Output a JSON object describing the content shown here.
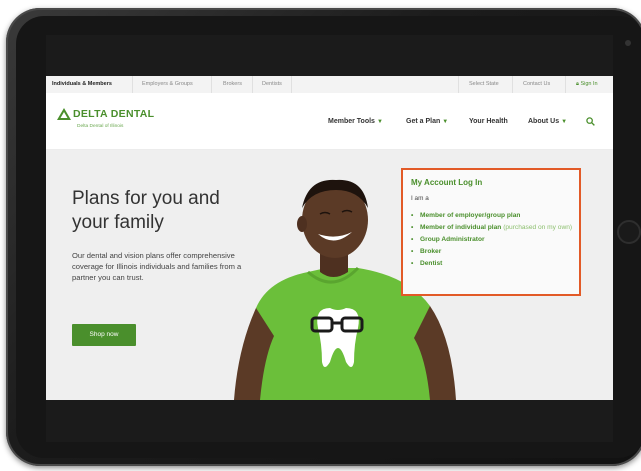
{
  "utility_bar": {
    "items": [
      "Individuals & Members",
      "Employers & Groups",
      "Brokers",
      "Dentists"
    ],
    "right_items": [
      "Select State",
      "Contact Us"
    ],
    "sign_in": "Sign In"
  },
  "header": {
    "logo_text": "DELTA DENTAL",
    "logo_subtext": "Delta Dental of Illinois",
    "nav": [
      {
        "label": "Member Tools",
        "dropdown": true
      },
      {
        "label": "Get a Plan",
        "dropdown": true
      },
      {
        "label": "Your Health",
        "dropdown": false
      },
      {
        "label": "About Us",
        "dropdown": true
      }
    ],
    "search_icon": "search-icon"
  },
  "hero": {
    "title": "Plans for you and your family",
    "text": "Our dental and vision plans offer comprehensive coverage for Illinois individuals and families from a partner you can trust.",
    "button_label": "Shop now"
  },
  "login": {
    "title": "My Account Log In",
    "intro": "I am a",
    "options": [
      {
        "label": "Member of employer/group plan",
        "note": ""
      },
      {
        "label": "Member of individual plan",
        "note": "(purchased on my own)"
      },
      {
        "label": "Group Administrator",
        "note": ""
      },
      {
        "label": "Broker",
        "note": ""
      },
      {
        "label": "Dentist",
        "note": ""
      }
    ]
  },
  "colors": {
    "brand_green": "#4a8f2c",
    "highlight_orange": "#e25a27"
  }
}
